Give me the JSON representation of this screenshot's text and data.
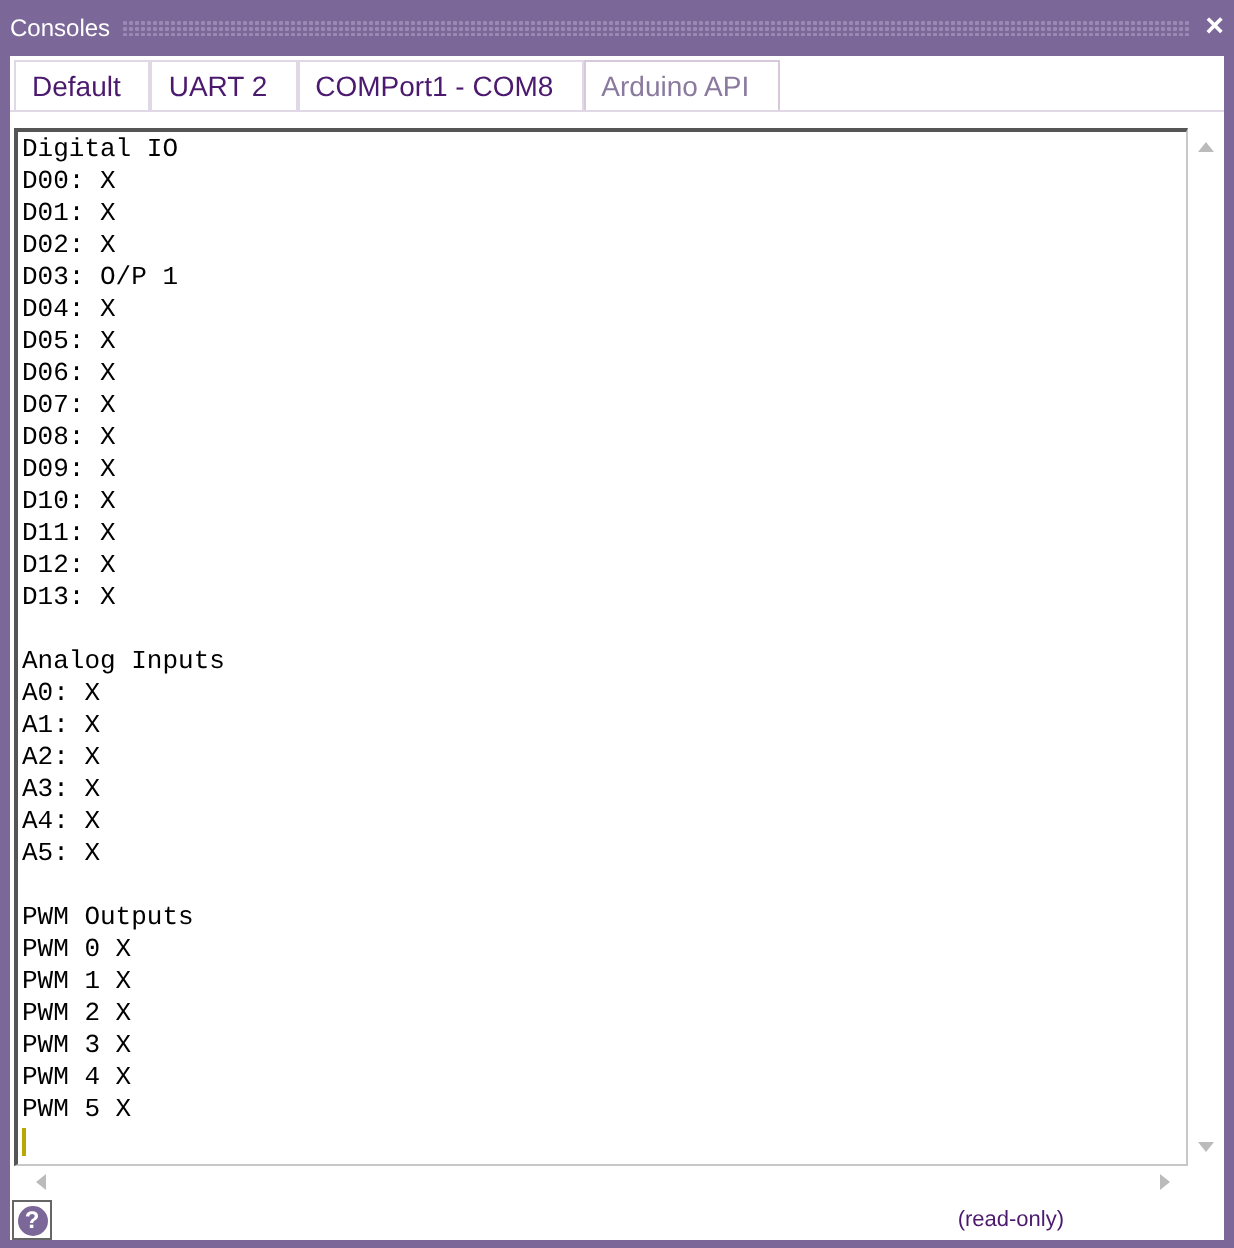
{
  "window": {
    "title": "Consoles",
    "close": "×"
  },
  "tabs": [
    {
      "label": "Default",
      "selected": false
    },
    {
      "label": "UART 2",
      "selected": false
    },
    {
      "label": "COMPort1 - COM8",
      "selected": false
    },
    {
      "label": "Arduino API",
      "selected": true
    }
  ],
  "console": {
    "sections": [
      {
        "heading": "Digital IO",
        "lines": [
          "D00: X",
          "D01: X",
          "D02: X",
          "D03: O/P 1",
          "D04: X",
          "D05: X",
          "D06: X",
          "D07: X",
          "D08: X",
          "D09: X",
          "D10: X",
          "D11: X",
          "D12: X",
          "D13: X"
        ]
      },
      {
        "heading": "Analog Inputs",
        "lines": [
          "A0: X",
          "A1: X",
          "A2: X",
          "A3: X",
          "A4: X",
          "A5: X"
        ]
      },
      {
        "heading": "PWM Outputs",
        "lines": [
          "PWM 0 X",
          "PWM 1 X",
          "PWM 2 X",
          "PWM 3 X",
          "PWM 4 X",
          "PWM 5 X"
        ]
      }
    ]
  },
  "status_bar": {
    "help": "?",
    "mode": "(read-only)"
  }
}
